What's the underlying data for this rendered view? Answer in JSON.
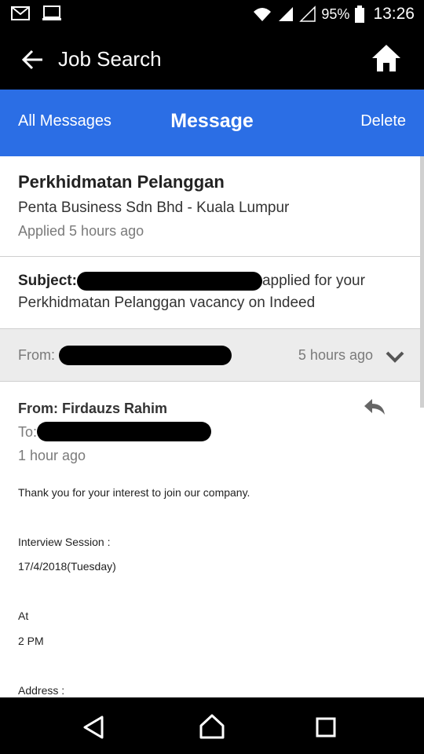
{
  "status_bar": {
    "battery_percent": "95%",
    "time": "13:26"
  },
  "app_bar": {
    "title": "Job Search"
  },
  "message_bar": {
    "left_label": "All Messages",
    "title": "Message",
    "right_label": "Delete"
  },
  "job": {
    "title": "Perkhidmatan Pelanggan",
    "company": "Penta Business Sdn Bhd - Kuala Lumpur",
    "applied": "Applied 5 hours ago"
  },
  "subject": {
    "label": "Subject:",
    "text_after_redaction": "applied for your",
    "line2": "Perkhidmatan Pelanggan vacancy on Indeed"
  },
  "from_row": {
    "label": "From:",
    "time": "5 hours ago"
  },
  "message": {
    "from": "From: Firdauzs Rahim",
    "to_label": "To:",
    "time": "1 hour ago",
    "lines": [
      "Thank you for your interest to join our company.",
      "Interview Session :",
      "17/4/2018(Tuesday)",
      "At",
      "2 PM",
      "Address :"
    ]
  },
  "colors": {
    "accent_blue": "#2b6ee5",
    "bar_black": "#000000",
    "from_row_bg": "#ececec"
  },
  "icons": {
    "status_left": [
      "gmail-icon",
      "screen-icon"
    ],
    "status_right": [
      "wifi-icon",
      "signal-icon",
      "battery-icon"
    ],
    "app_bar": [
      "back-arrow-icon",
      "home-icon"
    ],
    "from_row": "chevron-down-icon",
    "message": "reply-icon",
    "nav": [
      "nav-back-icon",
      "nav-home-icon",
      "nav-recents-icon"
    ]
  }
}
